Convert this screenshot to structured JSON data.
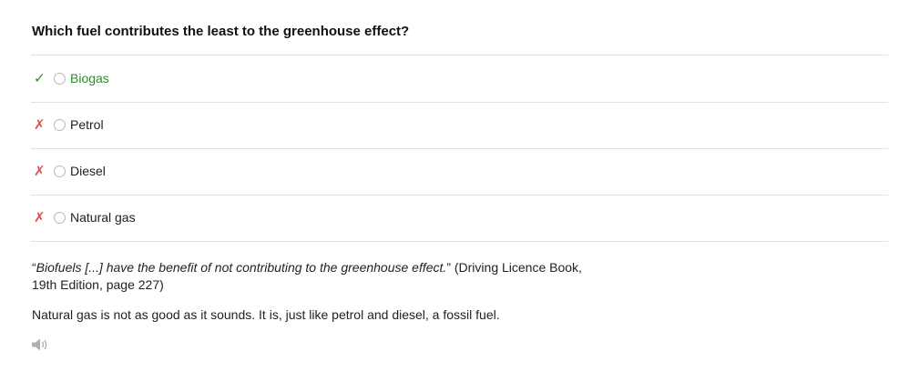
{
  "question": "Which fuel contributes the least to the greenhouse effect?",
  "answers": [
    {
      "mark": "✓",
      "label": "Biogas"
    },
    {
      "mark": "✗",
      "label": "Petrol"
    },
    {
      "mark": "✗",
      "label": "Diesel"
    },
    {
      "mark": "✗",
      "label": "Natural gas"
    }
  ],
  "explanation": {
    "quote_open": "“",
    "quote_text": "Biofuels [...] have the benefit of not contributing to the greenhouse effect.",
    "quote_close": "”",
    "source_line1": " (Driving Licence Book,",
    "source_line2": "19th Edition, page 227)",
    "note": "Natural gas is not as good as it sounds. It is, just like petrol and diesel, a fossil fuel."
  },
  "audio": {
    "icon": "speaker-icon"
  },
  "colors": {
    "correct": "#2e8b2e",
    "wrong": "#d9534f",
    "divider": "#e2e2e2"
  }
}
